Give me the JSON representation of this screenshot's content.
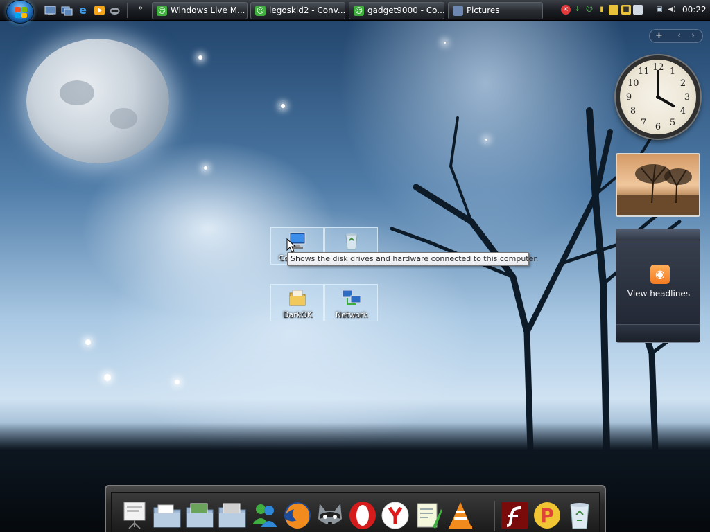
{
  "taskbar": {
    "start_button": "start-orb",
    "quick_launch": [
      {
        "name": "show-desktop",
        "icon": "desktop-icon"
      },
      {
        "name": "switch-windows",
        "icon": "switch-windows-icon"
      },
      {
        "name": "internet-explorer",
        "icon": "ie-icon"
      },
      {
        "name": "media-player",
        "icon": "media-player-icon"
      },
      {
        "name": "raccoon",
        "icon": "raccoon-icon"
      }
    ],
    "overflow_chevron": "»",
    "tasks": [
      {
        "label": "Windows Live M...",
        "icon": "messenger-icon",
        "color": "#3fae3f"
      },
      {
        "label": "legoskid2 - Conv...",
        "icon": "messenger-icon",
        "color": "#3fae3f"
      },
      {
        "label": "gadget9000 - Co...",
        "icon": "messenger-icon",
        "color": "#3fae3f"
      },
      {
        "label": "Pictures",
        "icon": "folder-icon",
        "color": "#6d88b0"
      }
    ],
    "tray_icons": [
      "security-alert-icon",
      "download-icon",
      "messenger-tray-icon",
      "signal-icon",
      "battery-icon",
      "usb-icon",
      "display-icon",
      "network-icon",
      "volume-icon"
    ],
    "time": "00:22"
  },
  "sidebar": {
    "add_button": "+",
    "prev_button": "‹",
    "next_button": "›",
    "clock": {
      "hour": 4,
      "minute": 0,
      "numbers": [
        "12",
        "1",
        "2",
        "3",
        "4",
        "5",
        "6",
        "7",
        "8",
        "9",
        "10",
        "11"
      ]
    },
    "feed": {
      "label": "View headlines"
    }
  },
  "desktop": {
    "icons": [
      {
        "label": "Computer",
        "icon": "computer-icon"
      },
      {
        "label": "",
        "icon": "recycle-bin-icon"
      },
      {
        "label": "DarkOK",
        "icon": "user-folder-icon"
      },
      {
        "label": "Network",
        "icon": "network-icon"
      }
    ],
    "tooltip": "Shows the disk drives and hardware connected to this computer."
  },
  "dock": {
    "items": [
      "presentation-icon",
      "documents-folder-icon",
      "pictures-folder-icon",
      "media-folder-icon",
      "messenger-icon",
      "firefox-icon",
      "raccoon-icon",
      "opera-icon",
      "yandex-icon",
      "notepad-icon",
      "vlc-icon",
      "flash-icon",
      "pidgin-icon",
      "recycle-bin-icon"
    ]
  },
  "colors": {
    "taskbar": "#1c1f24",
    "accent": "#2b7fd0",
    "rss": "#f57b20"
  }
}
